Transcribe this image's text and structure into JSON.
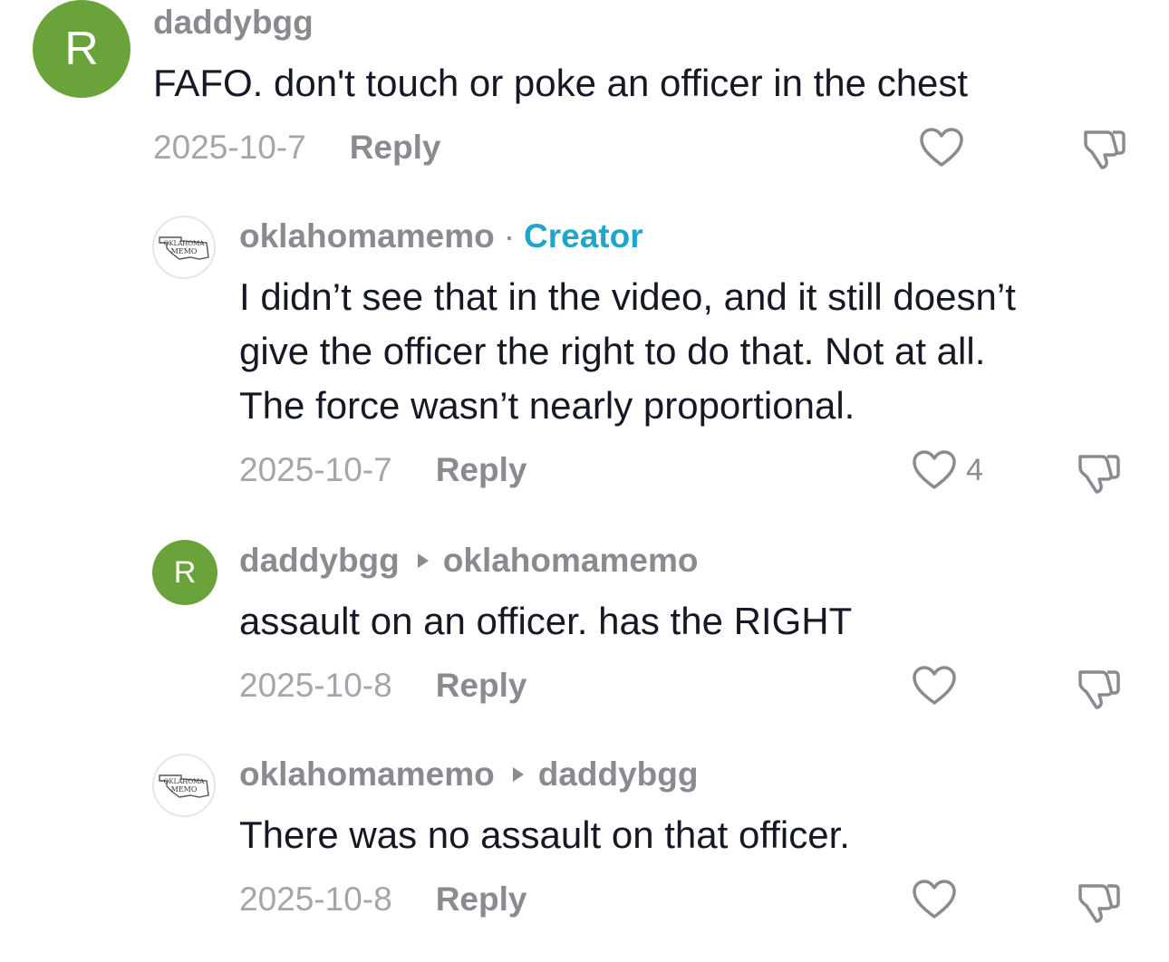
{
  "comments": [
    {
      "avatar_letter": "R",
      "avatar_color": "#6aa33a",
      "username": "daddybgg",
      "badge": "",
      "reply_to": "",
      "text": [
        "FAFO. don't touch or poke an officer in the chest"
      ],
      "date": "2025-10-7",
      "reply_label": "Reply",
      "likes": ""
    },
    {
      "avatar_text": "OKLAHOMA MEMO",
      "username": "oklahomamemo",
      "separator": "·",
      "badge": "Creator",
      "reply_to": "",
      "text": [
        "I didn’t see that in the video, and it still doesn’t",
        "give the officer the right to do that. Not at all.",
        "The force wasn’t nearly proportional."
      ],
      "date": "2025-10-7",
      "reply_label": "Reply",
      "likes": "4"
    },
    {
      "avatar_letter": "R",
      "avatar_color": "#6aa33a",
      "username": "daddybgg",
      "badge": "",
      "reply_to": "oklahomamemo",
      "text": [
        "assault on an officer. has the RIGHT"
      ],
      "date": "2025-10-8",
      "reply_label": "Reply",
      "likes": ""
    },
    {
      "avatar_text": "OKLAHOMA MEMO",
      "username": "oklahomamemo",
      "badge": "",
      "reply_to": "daddybgg",
      "text": [
        "There was no assault on that officer."
      ],
      "date": "2025-10-8",
      "reply_label": "Reply",
      "likes": ""
    }
  ],
  "colors": {
    "username": "#8a8b91",
    "creator_badge": "#1fa6c8",
    "text": "#161823",
    "avatar_green": "#6aa33a"
  }
}
